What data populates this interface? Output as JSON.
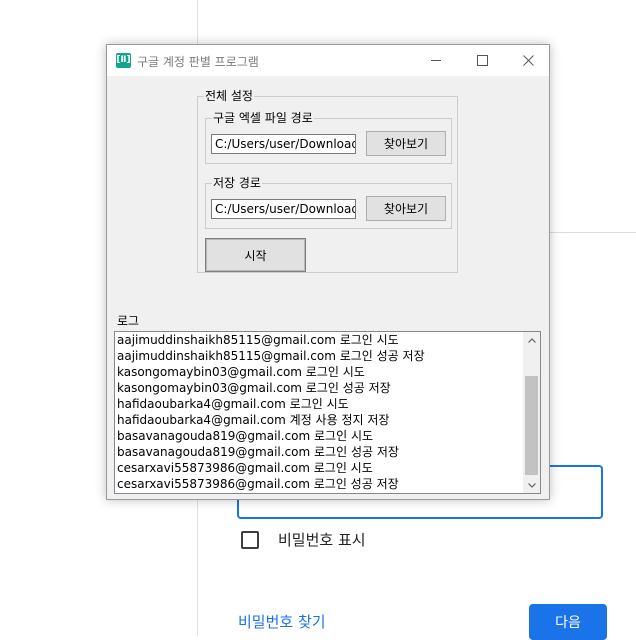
{
  "background": {
    "show_password_label": "비밀번호 표시",
    "find_password_link": "비밀번호 찾기",
    "next_button": "다음"
  },
  "window": {
    "title": "구글 계정 판별 프로그램",
    "icon_label": "[Ⅱ]",
    "controls": {
      "minimize": "—",
      "close": "✕"
    }
  },
  "settings": {
    "group_title": "전체 설정",
    "excel": {
      "group_title": "구글 엑셀 파일 경로",
      "value": "C:/Users/user/Downloads/",
      "browse_label": "찾아보기"
    },
    "save": {
      "group_title": "저장 경로",
      "value": "C:/Users/user/Downloads",
      "browse_label": "찾아보기"
    },
    "start_label": "시작"
  },
  "log": {
    "group_title": "로그",
    "lines": [
      "aajimuddinshaikh85115@gmail.com 로그인 시도",
      "aajimuddinshaikh85115@gmail.com 로그인 성공 저장",
      "kasongomaybin03@gmail.com 로그인 시도",
      "kasongomaybin03@gmail.com 로그인 성공 저장",
      "hafidaoubarka4@gmail.com 로그인 시도",
      "hafidaoubarka4@gmail.com 계정 사용 정지 저장",
      "basavanagouda819@gmail.com 로그인 시도",
      "basavanagouda819@gmail.com 로그인 성공 저장",
      "cesarxavi55873986@gmail.com 로그인 시도",
      "cesarxavi55873986@gmail.com 로그인 성공 저장"
    ]
  },
  "colors": {
    "accent": "#1a73e8",
    "app_icon": "#14a38b"
  },
  "icons": {
    "scroll_up": "chevron-up-icon",
    "scroll_down": "chevron-down-icon"
  }
}
